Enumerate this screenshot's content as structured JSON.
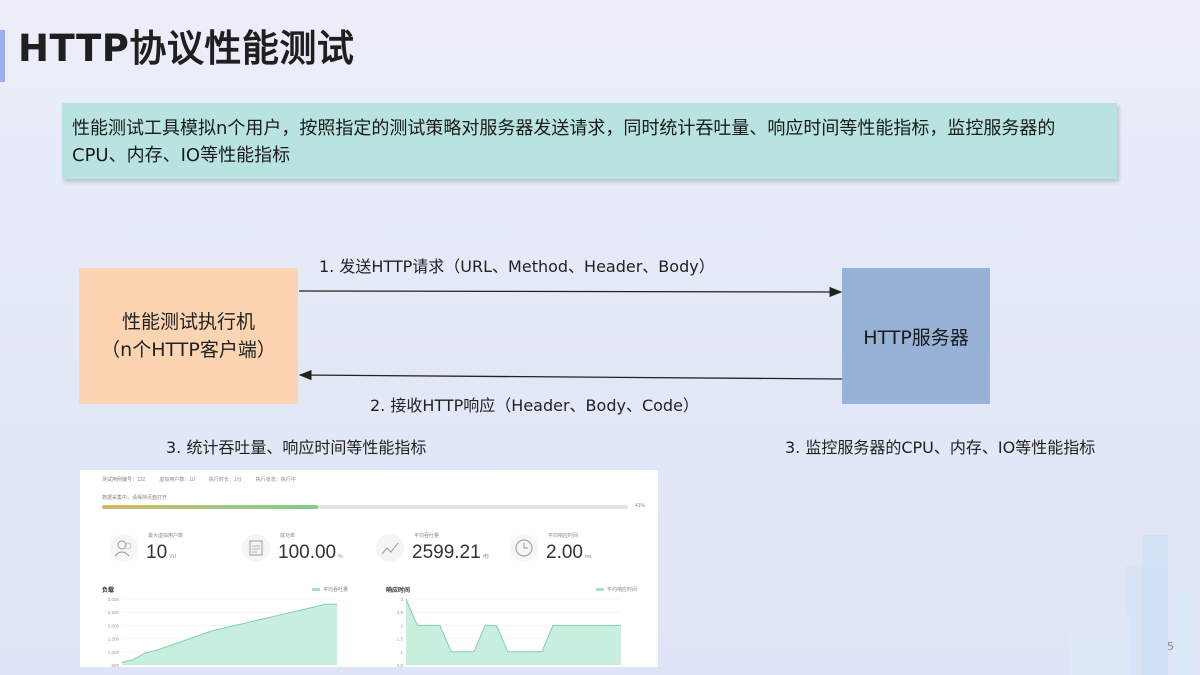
{
  "title": "HTTP协议性能测试",
  "description": "性能测试工具模拟n个用户，按照指定的测试策略对服务器发送请求，同时统计吞吐量、响应时间等性能指标，监控服务器的CPU、内存、IO等性能指标",
  "client": {
    "line1": "性能测试执行机",
    "line2": "（n个HTTP客户端）"
  },
  "server": {
    "label": "HTTP服务器"
  },
  "arrows": {
    "request": "1. 发送HTTP请求（URL、Method、Header、Body）",
    "response": "2. 接收HTTP响应（Header、Body、Code）"
  },
  "notes": {
    "client_stats": "3. 统计吞吐量、响应时间等性能指标",
    "server_monitor": "3. 监控服务器的CPU、内存、IO等性能指标"
  },
  "dashboard": {
    "top_items": [
      "测试用例编号：132",
      "虚拟用户数：10",
      "执行时长：1分",
      "执行状态：执行中"
    ],
    "progress_label": "数据采集中，请保持页面打开",
    "progress_fraction": 0.41,
    "progress_pct": "41%",
    "stats": [
      {
        "label": "最大虚拟用户数",
        "value": "10",
        "unit": "VU",
        "icon": "users-icon"
      },
      {
        "label": "成功率",
        "value": "100.00",
        "unit": "%",
        "icon": "checklist-icon"
      },
      {
        "label": "平均吞吐量",
        "value": "2599.21",
        "unit": "/秒",
        "icon": "trend-icon"
      },
      {
        "label": "平均响应时间",
        "value": "2.00",
        "unit": "ms",
        "icon": "clock-icon"
      }
    ],
    "load_panel": {
      "title": "负载",
      "legend": "平均吞吐量",
      "yticks": [
        "3,000",
        "2,500",
        "2,000",
        "1,500",
        "1,000",
        "500"
      ],
      "ylim": [
        500,
        3000
      ],
      "values": [
        600,
        700,
        950,
        1050,
        1200,
        1350,
        1500,
        1650,
        1800,
        1900,
        2000,
        2100,
        2200,
        2300,
        2400,
        2500,
        2600,
        2700,
        2800,
        2800
      ]
    },
    "response_panel": {
      "title": "响应时间",
      "legend": "平均响应时间",
      "yticks": [
        "3",
        "2.5",
        "2",
        "1.5",
        "1",
        "0.5"
      ],
      "ylim": [
        0.5,
        3
      ],
      "values": [
        3,
        2,
        2,
        2,
        1,
        1,
        1,
        2,
        2,
        1,
        1,
        1,
        1,
        2,
        2,
        2,
        2,
        2,
        2,
        2
      ]
    }
  },
  "page_number": "5",
  "colors": {
    "title_accent": "#9aaef0",
    "desc_bg": "#b9e3e0",
    "client_bg": "#fcd4b2",
    "server_bg": "#97b2d7",
    "chart_fill": "#c8eedd",
    "chart_line": "#7dd3aa"
  }
}
